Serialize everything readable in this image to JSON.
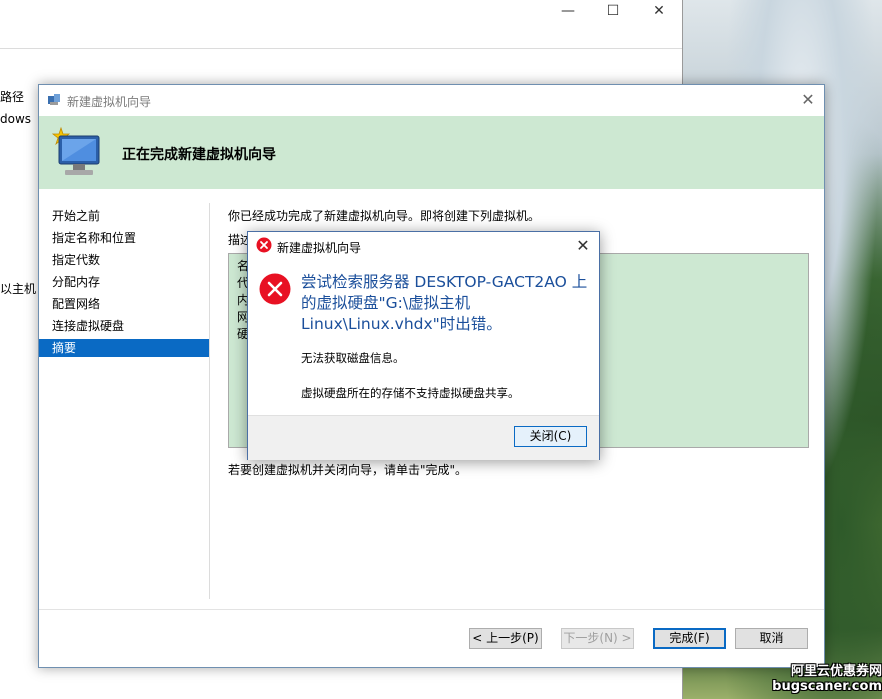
{
  "back_window": {
    "controls": {
      "minimize": "—",
      "maximize": "☐",
      "close": "✕"
    },
    "partial_labels": [
      "路径",
      "dows",
      "以主机Li"
    ]
  },
  "wizard": {
    "title": "新建虚拟机向导",
    "close_glyph": "✕",
    "header_title": "正在完成新建虚拟机向导",
    "nav": [
      {
        "label": "开始之前",
        "active": false
      },
      {
        "label": "指定名称和位置",
        "active": false
      },
      {
        "label": "指定代数",
        "active": false
      },
      {
        "label": "分配内存",
        "active": false
      },
      {
        "label": "配置网络",
        "active": false
      },
      {
        "label": "连接虚拟硬盘",
        "active": false
      },
      {
        "label": "摘要",
        "active": true
      }
    ],
    "intro": "你已经成功完成了新建虚拟机向导。即将创建下列虚拟机。",
    "description_label": "描述",
    "summary_lines": [
      "名",
      "代",
      "内",
      "网",
      "硬"
    ],
    "finish_text": "若要创建虚拟机并关闭向导，请单击\"完成\"。",
    "buttons": {
      "previous": "< 上一步(P)",
      "next": "下一步(N) >",
      "finish": "完成(F)",
      "cancel": "取消"
    }
  },
  "error_dialog": {
    "title": "新建虚拟机向导",
    "close_glyph": "✕",
    "main_message": "尝试检索服务器 DESKTOP-GACT2AO 上的虚拟硬盘\"G:\\虚拟主机 Linux\\Linux.vhdx\"时出错。",
    "detail_1": "无法获取磁盘信息。",
    "detail_2": "虚拟硬盘所在的存储不支持虚拟硬盘共享。",
    "close_button": "关闭(C)"
  },
  "watermark": {
    "line1": "阿里云优惠券网",
    "line2": "bugscaner.com"
  },
  "colors": {
    "accent": "#0a6ac4",
    "header_bg": "#cde8d2",
    "error_red": "#e81123",
    "message_blue": "#1b4f9b"
  }
}
